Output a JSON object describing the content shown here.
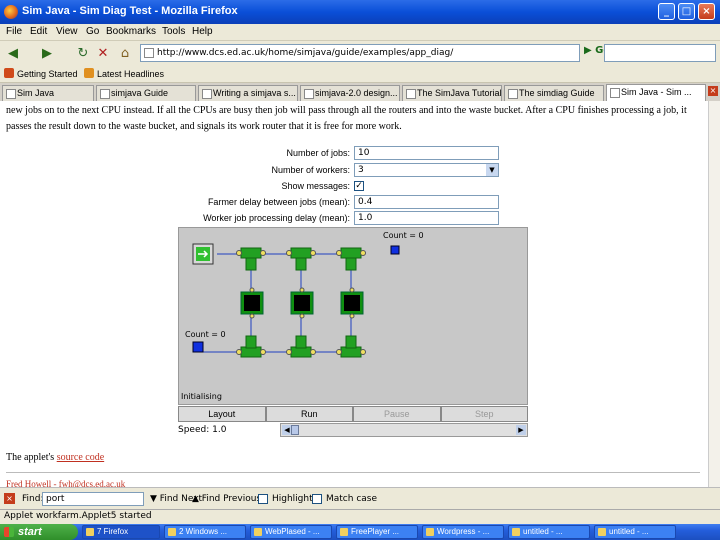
{
  "window": {
    "title": "Sim Java - Sim Diag Test - Mozilla Firefox",
    "minimize": "_",
    "maximize": "□",
    "close": "×"
  },
  "menu": [
    "File",
    "Edit",
    "View",
    "Go",
    "Bookmarks",
    "Tools",
    "Help"
  ],
  "nav": {
    "back_icon": "back-arrow-icon",
    "url": "http://www.dcs.ed.ac.uk/home/simjava/guide/examples/app_diag/",
    "go_label": "Go"
  },
  "bookmarks": [
    {
      "label": "Getting Started",
      "color": "#d04a1a"
    },
    {
      "label": "Latest Headlines",
      "color": "#e09020"
    }
  ],
  "tabs": [
    {
      "label": "Sim Java"
    },
    {
      "label": "simjava Guide"
    },
    {
      "label": "Writing a simjava s..."
    },
    {
      "label": "simjava-2.0 design..."
    },
    {
      "label": "The SimJava Tutorial"
    },
    {
      "label": "The simdiag Guide"
    },
    {
      "label": "Sim Java - Sim ...",
      "active": true
    }
  ],
  "page": {
    "intro_text": "new jobs on to the next CPU instead. If all the CPUs are busy then job will pass through all the routers and into the waste bucket. After a CPU finishes processing a job, it passes the result down to the waste bucket, and signals its work router that it is free for more work.",
    "form": {
      "jobs_label": "Number of jobs:",
      "jobs_value": "10",
      "workers_label": "Number of workers:",
      "workers_value": "3",
      "messages_label": "Show messages:",
      "messages_checked": "✓",
      "farmer_label": "Farmer delay between jobs (mean):",
      "farmer_value": "0.4",
      "worker_label": "Worker job processing delay (mean):",
      "worker_value": "1.0"
    },
    "applet": {
      "count_top": "Count = 0",
      "count_left": "Count = 0",
      "status": "Initialising",
      "buttons": [
        {
          "label": "Layout",
          "disabled": false
        },
        {
          "label": "Run",
          "disabled": false
        },
        {
          "label": "Pause",
          "disabled": true
        },
        {
          "label": "Step",
          "disabled": true
        }
      ],
      "speed_label": "Speed: 1.0"
    },
    "source_prefix": "The applet's",
    "source_link": "source code",
    "footer_link": "Fred Howell - fwh@dcs.ed.ac.uk"
  },
  "findbar": {
    "label": "Find:",
    "value": "port",
    "next_label": "Find Next",
    "prev_label": "Find Previous",
    "highlight_label": "Highlight",
    "matchcase_label": "Match case"
  },
  "status": "Applet workfarm.Applet5 started",
  "taskbar": {
    "start_label": "start",
    "tasks": [
      {
        "label": "7 Firefox",
        "active": true
      },
      {
        "label": "2 Windows ..."
      },
      {
        "label": "WebPlased - ..."
      },
      {
        "label": "FreePlayer ..."
      },
      {
        "label": "Wordpress - ..."
      },
      {
        "label": "untitled - ..."
      },
      {
        "label": "untitled - ..."
      }
    ]
  }
}
